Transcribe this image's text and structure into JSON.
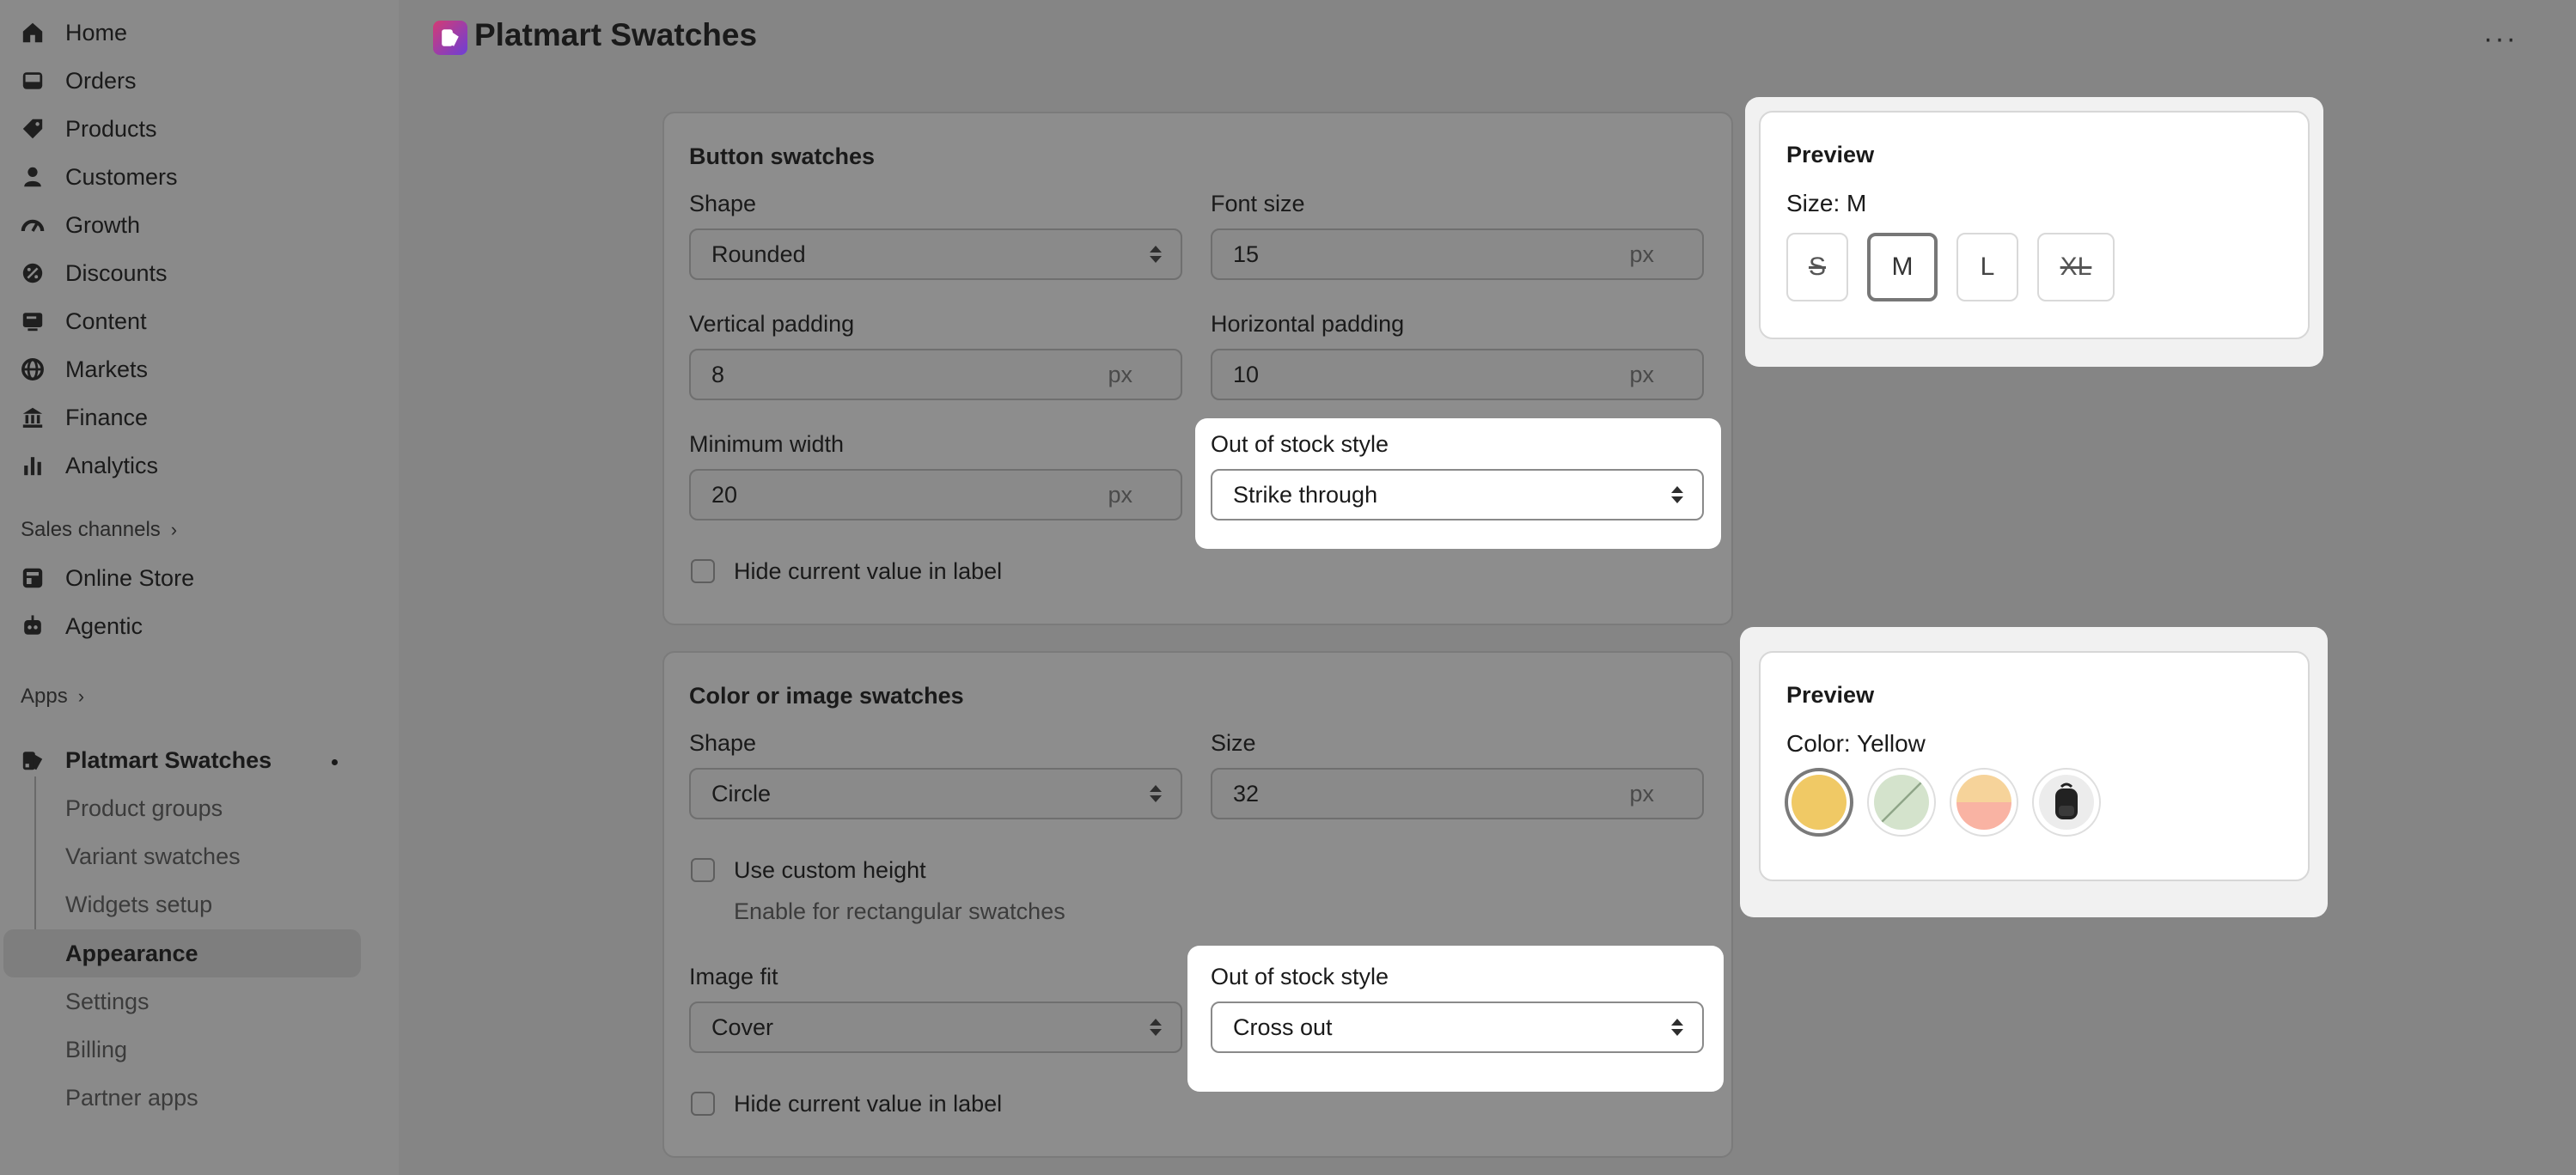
{
  "sidebar": {
    "nav": [
      {
        "label": "Home",
        "icon": "home-icon"
      },
      {
        "label": "Orders",
        "icon": "orders-inbox-icon"
      },
      {
        "label": "Products",
        "icon": "tag-icon"
      },
      {
        "label": "Customers",
        "icon": "person-icon"
      },
      {
        "label": "Growth",
        "icon": "gauge-icon"
      },
      {
        "label": "Discounts",
        "icon": "discount-badge-icon"
      },
      {
        "label": "Content",
        "icon": "content-monitor-icon"
      },
      {
        "label": "Markets",
        "icon": "globe-icon"
      },
      {
        "label": "Finance",
        "icon": "bank-icon"
      },
      {
        "label": "Analytics",
        "icon": "bar-chart-icon"
      }
    ],
    "sales_channels": {
      "heading": "Sales channels",
      "chevron": "›"
    },
    "channels": [
      {
        "label": "Online Store",
        "icon": "store-icon"
      },
      {
        "label": "Agentic",
        "icon": "robot-icon"
      }
    ],
    "apps": {
      "heading": "Apps",
      "chevron": "›"
    },
    "app": {
      "label": "Platmart Swatches",
      "icon": "app-swatch-icon"
    },
    "sub_items": [
      "Product groups",
      "Variant swatches",
      "Widgets setup",
      "Appearance",
      "Settings",
      "Billing",
      "Partner apps"
    ],
    "active_sub_item": "Appearance"
  },
  "header": {
    "title": "Platmart Swatches",
    "more": "···",
    "logo_colors": [
      "#d33c74",
      "#6d3fd6"
    ]
  },
  "button_swatches": {
    "title": "Button swatches",
    "shape": {
      "label": "Shape",
      "value": "Rounded"
    },
    "font_size": {
      "label": "Font size",
      "value": "15",
      "unit": "px"
    },
    "vertical_padding": {
      "label": "Vertical padding",
      "value": "8",
      "unit": "px"
    },
    "horizontal_padding": {
      "label": "Horizontal padding",
      "value": "10",
      "unit": "px"
    },
    "minimum_width": {
      "label": "Minimum width",
      "value": "20",
      "unit": "px"
    },
    "out_of_stock_style": {
      "label": "Out of stock style",
      "value": "Strike through"
    },
    "hide_current_value": {
      "label": "Hide current value in label",
      "checked": false
    }
  },
  "button_preview": {
    "title": "Preview",
    "label": "Size: M",
    "options": [
      {
        "text": "S",
        "selected": false,
        "out_of_stock": true
      },
      {
        "text": "M",
        "selected": true,
        "out_of_stock": false
      },
      {
        "text": "L",
        "selected": false,
        "out_of_stock": false
      },
      {
        "text": "XL",
        "selected": false,
        "out_of_stock": true
      }
    ]
  },
  "color_swatches": {
    "title": "Color or image swatches",
    "shape": {
      "label": "Shape",
      "value": "Circle"
    },
    "size": {
      "label": "Size",
      "value": "32",
      "unit": "px"
    },
    "use_custom_height": {
      "label": "Use custom height",
      "checked": false,
      "hint": "Enable for rectangular swatches"
    },
    "image_fit": {
      "label": "Image fit",
      "value": "Cover"
    },
    "out_of_stock_style": {
      "label": "Out of stock style",
      "value": "Cross out"
    },
    "hide_current_value": {
      "label": "Hide current value in label",
      "checked": false
    }
  },
  "color_preview": {
    "title": "Preview",
    "label": "Color: Yellow",
    "swatches": [
      {
        "name": "yellow-swatch",
        "color": "#f0c965",
        "selected": true
      },
      {
        "name": "sage-swatch",
        "color": "#d4e3cc",
        "selected": false,
        "crossed": true
      },
      {
        "name": "peach-swatch",
        "colors": [
          "#f6d39a",
          "#f9b3a3"
        ],
        "selected": false
      },
      {
        "name": "backpack-swatch",
        "color": "#222222",
        "selected": false
      }
    ]
  }
}
